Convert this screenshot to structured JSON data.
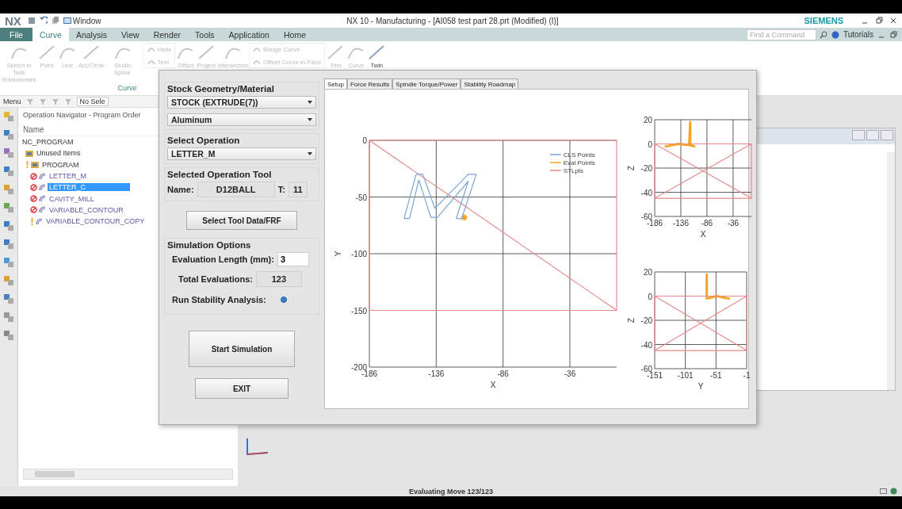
{
  "window": {
    "logo": "NX",
    "quick_menu": "Window",
    "title": "NX 10 - Manufacturing - [AI058 test part 28.prt (Modified)   (I)]",
    "brand": "SIEMENS"
  },
  "menu_tabs": [
    {
      "label": "File",
      "kind": "file",
      "selected": false
    },
    {
      "label": "Curve",
      "kind": "tab",
      "selected": true
    },
    {
      "label": "Analysis",
      "kind": "tab",
      "selected": false
    },
    {
      "label": "View",
      "kind": "tab",
      "selected": false
    },
    {
      "label": "Render",
      "kind": "tab",
      "selected": false
    },
    {
      "label": "Tools",
      "kind": "tab",
      "selected": false
    },
    {
      "label": "Application",
      "kind": "tab",
      "selected": false
    },
    {
      "label": "Home",
      "kind": "tab",
      "selected": false
    }
  ],
  "command_search": {
    "placeholder": "Find a Command"
  },
  "tutorials": "Tutorials",
  "ribbon": {
    "groups": [
      {
        "label": "Curve",
        "commands": [
          {
            "label": "Sketch in Task Environment",
            "kind": "large",
            "disabled": true
          },
          {
            "label": "Point",
            "kind": "large",
            "disabled": true
          },
          {
            "label": "Line",
            "kind": "large",
            "disabled": true
          },
          {
            "label": "Arc/Circle",
            "kind": "large",
            "disabled": true
          },
          {
            "label": "Studio Spline",
            "kind": "large",
            "disabled": true
          }
        ]
      },
      {
        "commands": [
          {
            "label": "Helix",
            "kind": "small",
            "disabled": true
          },
          {
            "label": "Text",
            "kind": "small",
            "disabled": true
          },
          {
            "label": "Offset",
            "kind": "large",
            "disabled": true
          },
          {
            "label": "Project",
            "kind": "large",
            "disabled": true
          },
          {
            "label": "Intersection",
            "kind": "large",
            "disabled": true
          },
          {
            "label": "Bridge Curve",
            "kind": "small",
            "disabled": true
          },
          {
            "label": "Offset Curve in Face",
            "kind": "small",
            "disabled": true
          },
          {
            "label": "Trim",
            "kind": "large",
            "disabled": true
          },
          {
            "label": "Curve",
            "kind": "large",
            "disabled": true
          },
          {
            "label": "Twin",
            "kind": "large",
            "disabled": false
          }
        ]
      }
    ]
  },
  "nav_toolbar": {
    "menu": "Menu",
    "selection": "No Sele"
  },
  "navigator": {
    "title": "Operation Navigator - Program Order",
    "column": "Name",
    "tree": [
      {
        "label": "NC_PROGRAM",
        "error": false,
        "warning": false,
        "selected": false,
        "children": [
          {
            "label": "Unused Items",
            "kind": "folder",
            "error": false,
            "warning": false,
            "selected": false
          },
          {
            "label": "PROGRAM",
            "kind": "folder",
            "error": false,
            "warning": true,
            "selected": false,
            "children": [
              {
                "label": "LETTER_M",
                "kind": "operation",
                "error": true,
                "warning": false,
                "selected": false
              },
              {
                "label": "LETTER_C",
                "kind": "operation",
                "error": true,
                "warning": false,
                "selected": true
              },
              {
                "label": "CAVITY_MILL",
                "kind": "operation",
                "error": true,
                "warning": false,
                "selected": false
              },
              {
                "label": "VARIABLE_CONTOUR",
                "kind": "operation",
                "error": true,
                "warning": false,
                "selected": false
              },
              {
                "label": "VARIABLE_CONTOUR_COPY",
                "kind": "operation",
                "error": false,
                "warning": true,
                "selected": false
              }
            ]
          }
        ]
      }
    ]
  },
  "dialog": {
    "stock": {
      "heading": "Stock Geometry/Material",
      "geometry": "STOCK (EXTRUDE(7))",
      "material": "Aluminum"
    },
    "operation": {
      "heading": "Select Operation",
      "value": "LETTER_M"
    },
    "tool": {
      "heading": "Selected Operation Tool",
      "name_label": "Name:",
      "name": "D12BALL",
      "t_label": "T:",
      "t": "11"
    },
    "tool_data_button": "Select Tool Data/FRF",
    "simulation": {
      "heading": "Simulation Options",
      "length_label": "Evaluation Length (mm):",
      "length": "3",
      "total_label": "Total Evaluations:",
      "total": "123",
      "stability_label": "Run Stability Analysis:",
      "stability_checked": true
    },
    "start_button": "Start Simulation",
    "exit_button": "EXIT",
    "tabs": [
      {
        "label": "Setup",
        "selected": true
      },
      {
        "label": "Force Results",
        "selected": false
      },
      {
        "label": "Spindle Torque/Power",
        "selected": false
      },
      {
        "label": "Stability Roadmap",
        "selected": false
      }
    ],
    "charts": [
      {
        "chart_data": {
          "type": "line",
          "xlabel": "X",
          "ylabel": "Y",
          "xlim": [
            -186,
            -1
          ],
          "ylim": [
            -200,
            0
          ],
          "xticks": [
            -186,
            -136,
            -86,
            -36
          ],
          "yticks": [
            0,
            -50,
            -100,
            -150,
            -200
          ],
          "grid": true,
          "legend": true,
          "series": [
            {
              "name": "CLS Points",
              "color": "#7aa6d6"
            },
            {
              "name": "Eval Points",
              "color": "#f5a623",
              "marker": true,
              "x": [
                -115
              ],
              "values": [
                -68
              ]
            },
            {
              "name": "STLpts",
              "color": "#e88a8a",
              "x": [
                -186,
                -1,
                -1,
                -186,
                -186,
                -1
              ],
              "values": [
                0,
                0,
                -150,
                -150,
                0,
                -150
              ]
            }
          ]
        }
      },
      {
        "chart_data": {
          "type": "line",
          "xlabel": "X",
          "ylabel": "Z",
          "xlim": [
            -186,
            -1
          ],
          "ylim": [
            -60,
            20
          ],
          "xticks": [
            -186,
            -136,
            -86,
            -36
          ],
          "yticks": [
            20,
            0,
            -20,
            -40,
            -60
          ],
          "grid": true,
          "series": [
            {
              "color": "#f5a623",
              "marker": true,
              "x": [
                -165,
                -140,
                -120,
                -118,
                -118,
                -110
              ],
              "values": [
                -2,
                0,
                -1,
                18,
                -1,
                -2
              ]
            },
            {
              "color": "#e88a8a",
              "x": [
                -186,
                -1,
                -1,
                -186,
                -186,
                -1,
                -186,
                -1
              ],
              "values": [
                0,
                0,
                -45,
                -45,
                0,
                -45,
                -45,
                0
              ]
            }
          ]
        }
      },
      {
        "chart_data": {
          "type": "line",
          "xlabel": "Y",
          "ylabel": "Z",
          "xlim": [
            -151,
            -1
          ],
          "ylim": [
            -60,
            20
          ],
          "xticks": [
            -151,
            -101,
            -51,
            -1
          ],
          "yticks": [
            20,
            0,
            -20,
            -40,
            -60
          ],
          "grid": true,
          "series": [
            {
              "color": "#f5a623",
              "marker": true,
              "x": [
                -66,
                -66,
                -50,
                -30
              ],
              "values": [
                18,
                -2,
                0,
                -2
              ]
            },
            {
              "color": "#e88a8a",
              "x": [
                -151,
                -1,
                -1,
                -151,
                -151,
                -1,
                -151,
                -1
              ],
              "values": [
                0,
                0,
                -45,
                -45,
                0,
                -45,
                -45,
                0
              ]
            }
          ]
        }
      }
    ]
  },
  "status_bar": "Evaluating Move 123/123"
}
